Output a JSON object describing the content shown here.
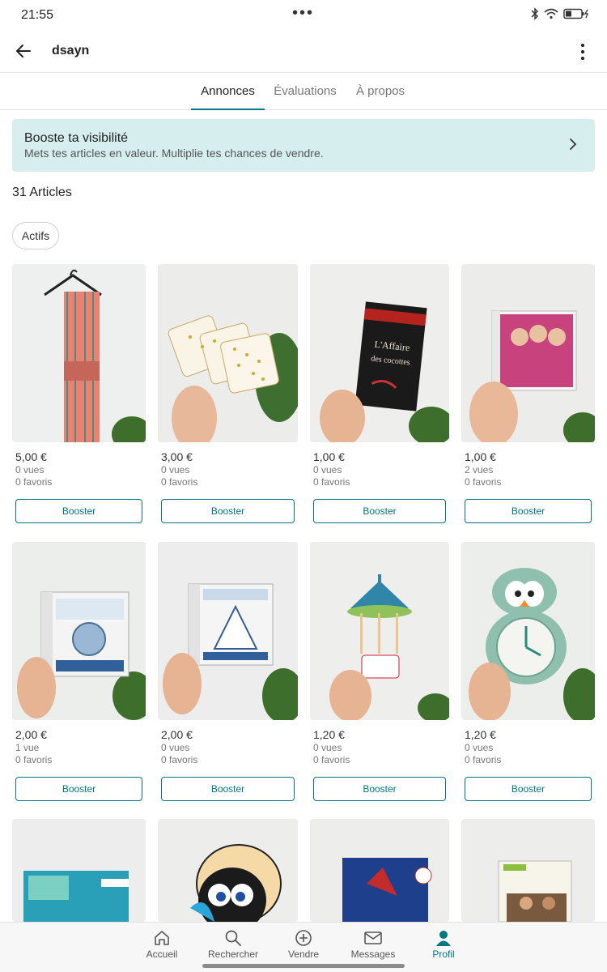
{
  "status": {
    "time": "21:55",
    "dots": "•••"
  },
  "header": {
    "username": "dsayn"
  },
  "tabs": [
    {
      "label": "Annonces",
      "active": true
    },
    {
      "label": "Évaluations",
      "active": false
    },
    {
      "label": "À propos",
      "active": false
    }
  ],
  "boost": {
    "title": "Booste ta visibilité",
    "subtitle": "Mets tes articles en valeur. Multiplie tes chances de vendre."
  },
  "count": "31 Articles",
  "filter_chip": "Actifs",
  "items": [
    {
      "price": "5,00 €",
      "views": "0 vues",
      "favs": "0 favoris",
      "button": "Booster",
      "image": "scarf"
    },
    {
      "price": "3,00 €",
      "views": "0 vues",
      "favs": "0 favoris",
      "button": "Booster",
      "image": "coasters"
    },
    {
      "price": "1,00 €",
      "views": "0 vues",
      "favs": "0 favoris",
      "button": "Booster",
      "image": "book-black"
    },
    {
      "price": "1,00 €",
      "views": "2 vues",
      "favs": "0 favoris",
      "button": "Booster",
      "image": "ds-game-pink"
    },
    {
      "price": "2,00 €",
      "views": "1 vue",
      "favs": "0 favoris",
      "button": "Booster",
      "image": "ds-game-brain"
    },
    {
      "price": "2,00 €",
      "views": "0 vues",
      "favs": "0 favoris",
      "button": "Booster",
      "image": "ds-game-english"
    },
    {
      "price": "1,20 €",
      "views": "0 vues",
      "favs": "0 favoris",
      "button": "Booster",
      "image": "carousel"
    },
    {
      "price": "1,20 €",
      "views": "0 vues",
      "favs": "0 favoris",
      "button": "Booster",
      "image": "penguin-clock"
    },
    {
      "image": "puzzle"
    },
    {
      "image": "calimero"
    },
    {
      "image": "book-noel"
    },
    {
      "image": "book-jo"
    }
  ],
  "bottom_nav": [
    {
      "label": "Accueil",
      "icon": "home-icon",
      "active": false
    },
    {
      "label": "Rechercher",
      "icon": "search-icon",
      "active": false
    },
    {
      "label": "Vendre",
      "icon": "plus-circle-icon",
      "active": false
    },
    {
      "label": "Messages",
      "icon": "mail-icon",
      "active": false
    },
    {
      "label": "Profil",
      "icon": "profile-icon",
      "active": true
    }
  ],
  "colors": {
    "accent": "#007782",
    "banner": "#d7eeee"
  }
}
